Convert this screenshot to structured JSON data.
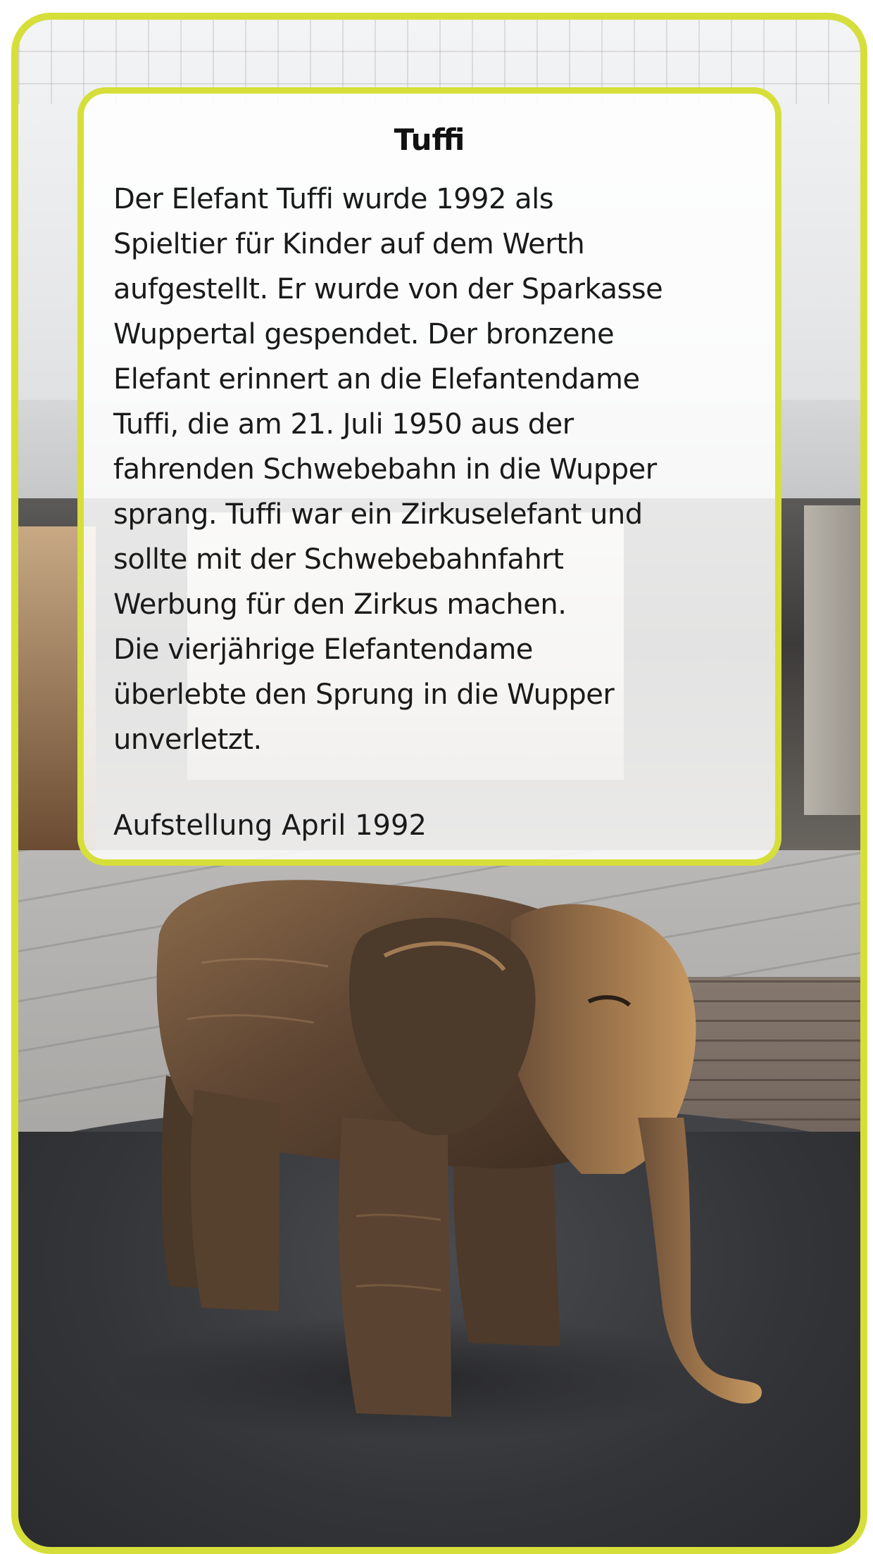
{
  "colors": {
    "frame": "#d6df3a",
    "card_background": "#ffffff",
    "text": "#1a1a1a"
  },
  "card": {
    "title": "Tuffi",
    "body": "Der Elefant Tuffi wurde 1992 als\nSpieltier für Kinder auf dem Werth\naufgestellt. Er wurde von der Sparkasse\nWuppertal gespendet. Der bronzene\nElefant erinnert an die Elefantendame\nTuffi, die am 21. Juli 1950 aus der\nfahrenden Schwebebahn in die Wupper\nsprang. Tuffi war ein Zirkuselefant und\nsollte mit der Schwebebahnfahrt\nWerbung für den Zirkus machen.\nDie vierjährige Elefantendame\nüberlebte den Sprung in die Wupper\nunverletzt.",
    "footer": "Aufstellung April 1992"
  },
  "photo": {
    "subject_icon": "elephant-statue"
  }
}
